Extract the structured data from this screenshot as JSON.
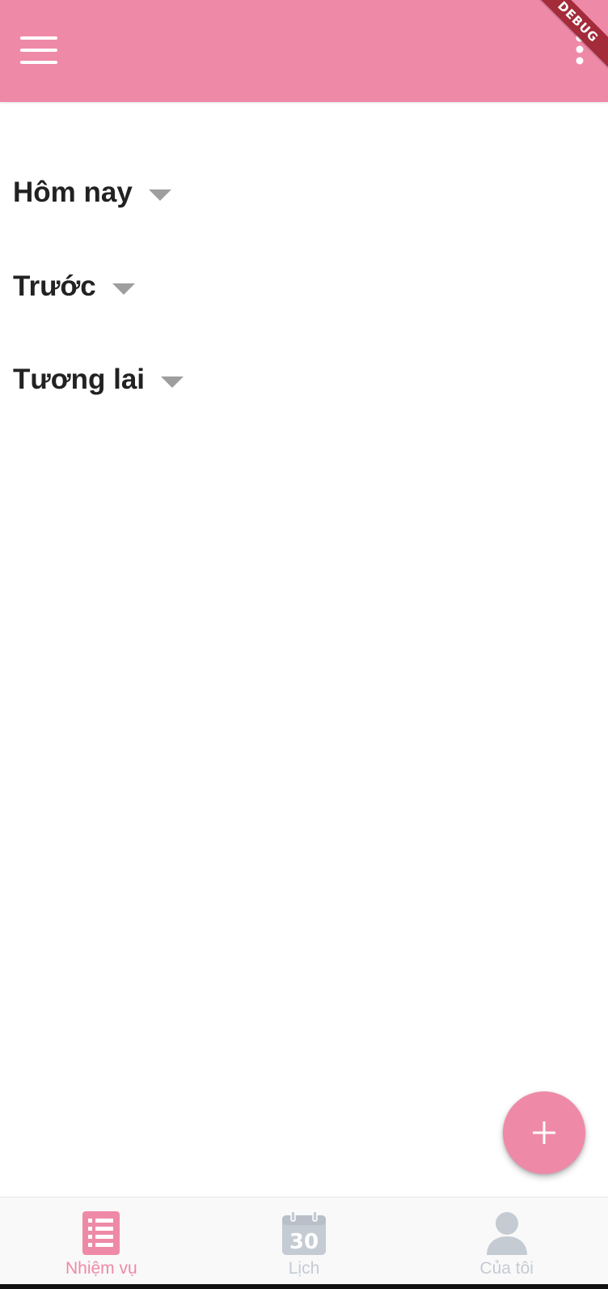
{
  "app_bar": {
    "menu_icon": "hamburger-menu-icon",
    "more_icon": "more-vertical-icon",
    "debug_banner": "DEBUG",
    "color": "#EF89A8"
  },
  "sections": [
    {
      "title": "Hôm nay"
    },
    {
      "title": "Trước"
    },
    {
      "title": "Tương lai"
    }
  ],
  "fab": {
    "icon": "plus-icon",
    "symbol": "+"
  },
  "bottom_nav": {
    "active_color": "#EF89A8",
    "inactive_color": "#C5CBD3",
    "items": [
      {
        "label": "Nhiệm vụ",
        "icon": "task-list-icon",
        "active": true
      },
      {
        "label": "Lịch",
        "icon": "calendar-icon",
        "icon_text": "30",
        "active": false
      },
      {
        "label": "Của tôi",
        "icon": "user-icon",
        "active": false
      }
    ]
  }
}
